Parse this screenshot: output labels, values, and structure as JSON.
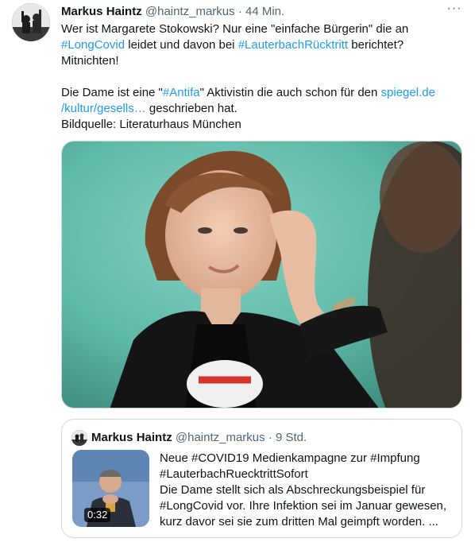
{
  "tweet": {
    "author_name": "Markus Haintz",
    "author_handle": "@haintz_markus",
    "separator": "·",
    "time": "44 Min.",
    "more_label": "···",
    "line1a": "Wer ist Margarete Stokowski? Nur eine \"einfache Bürgerin\" die an",
    "hashtag_longcovid": "#LongCovid",
    "line2b": " leidet und davon bei ",
    "hashtag_lauterbach": "#LauterbachRücktritt",
    "line2d": " berichtet?",
    "line3": "Mitnichten!",
    "line4a": "Die Dame ist eine \"",
    "hashtag_antifa": "#Antifa",
    "line4c": "\" Aktivistin die auch schon für den ",
    "link_part1": "spiegel.de",
    "link_part2": "/kultur/gesells…",
    "line5b": " geschrieben hat.",
    "line6": "Bildquelle: Literaturhaus München"
  },
  "quote": {
    "author_name": "Markus Haintz",
    "author_handle": "@haintz_markus",
    "separator": "·",
    "time": "9 Std.",
    "video_duration": "0:32",
    "line1": "Neue #COVID19 Medienkampagne zur #Impfung",
    "line2": "#LauterbachRuecktrittSofort",
    "line3": "Die Dame stellt sich als Abschreckungsbeispiel für",
    "line4": "#LongCovid vor. Ihre Infektion sei im Januar gewesen,",
    "line5": "kurz davor sei sie zum dritten Mal geimpft worden. ..."
  },
  "colors": {
    "link": "#1d9bf0",
    "secondary_text": "#536471",
    "border": "#cfd9de",
    "photo_background": "#5fb9a8"
  }
}
